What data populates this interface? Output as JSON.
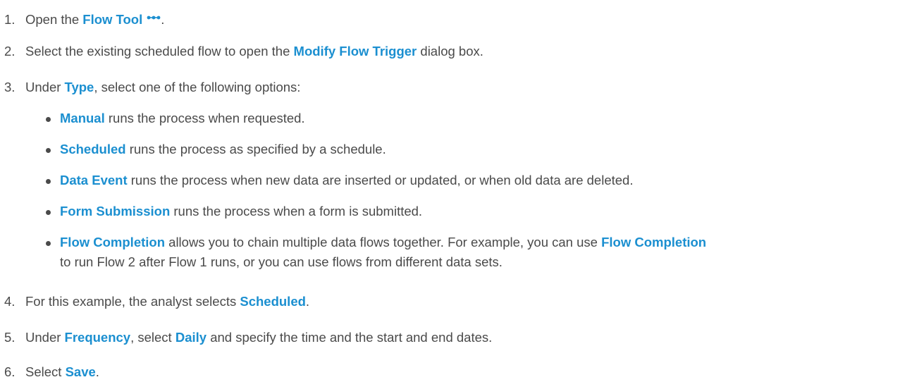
{
  "steps": [
    {
      "num": "1.",
      "pre": "Open the ",
      "kw": "Flow Tool",
      "post": "."
    },
    {
      "num": "2.",
      "pre": "Select the existing scheduled flow to open the ",
      "kw": "Modify Flow Trigger",
      "post": " dialog box."
    },
    {
      "num": "3.",
      "pre": "Under ",
      "kw": "Type",
      "post": ", select one of the following options:"
    },
    {
      "num": "4.",
      "pre": "For this example, the analyst selects ",
      "kw": "Scheduled",
      "post": "."
    },
    {
      "num": "5.",
      "pre": "Under ",
      "kw": "Frequency",
      "mid": ", select ",
      "kw2": "Daily",
      "post": " and specify the time and the start and end dates."
    },
    {
      "num": "6.",
      "pre": "Select ",
      "kw": "Save",
      "post": "."
    }
  ],
  "options": [
    {
      "kw": "Manual",
      "text": " runs the process when requested."
    },
    {
      "kw": "Scheduled",
      "text": " runs the process as specified by a schedule."
    },
    {
      "kw": "Data Event",
      "text": " runs the process when new data are inserted or updated, or when old data are deleted."
    },
    {
      "kw": "Form Submission",
      "text": " runs the process when a form is submitted."
    },
    {
      "kw": "Flow Completion",
      "text": " allows you to chain multiple data flows together. For example, you can use ",
      "kw2": "Flow Completion",
      "cont": "to run Flow 2 after Flow 1 runs, or you can use flows from different data sets."
    }
  ],
  "icons": {
    "flow_tool": "flow-dots-icon"
  },
  "colors": {
    "keyword": "#1b8fd0",
    "text": "#4a4a4a"
  }
}
